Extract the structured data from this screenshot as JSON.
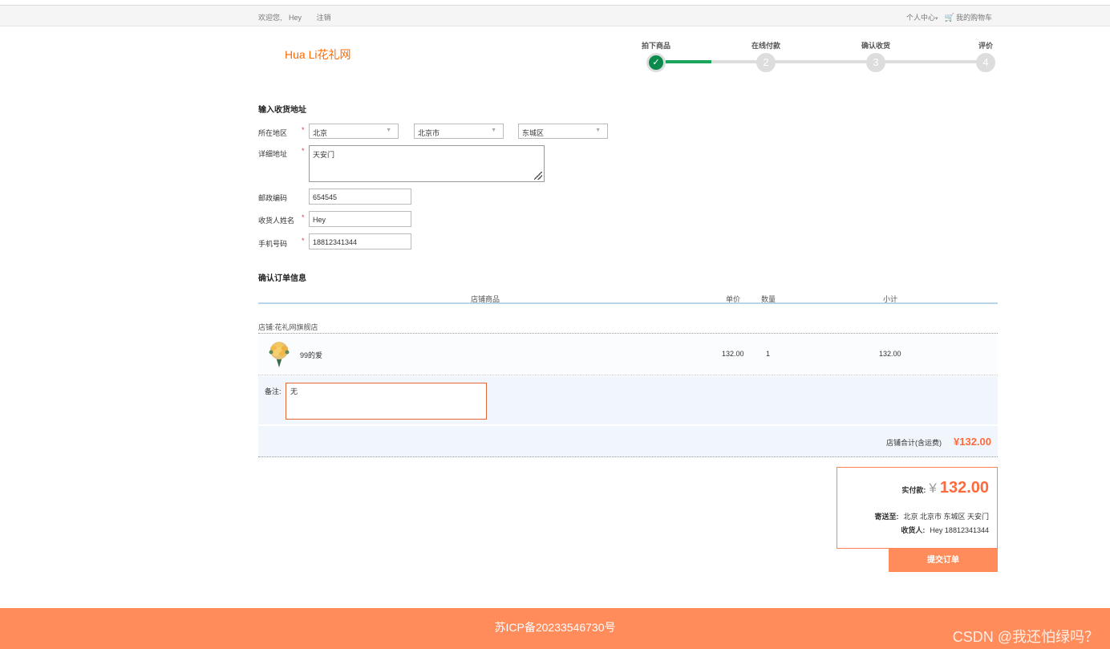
{
  "topbar": {
    "welcome": "欢迎您,",
    "username": "Hey",
    "logout": "注销",
    "personal_center": "个人中心",
    "cart": "我的购物车"
  },
  "brand": "Hua Li花礼网",
  "steps": [
    {
      "label": "拍下商品",
      "num": "",
      "done": true
    },
    {
      "label": "在线付款",
      "num": "2"
    },
    {
      "label": "确认收货",
      "num": "3"
    },
    {
      "label": "评价",
      "num": "4"
    }
  ],
  "address": {
    "title": "输入收货地址",
    "region_label": "所在地区",
    "province": "北京",
    "city": "北京市",
    "district": "东城区",
    "detail_label": "详细地址",
    "detail": "天安门",
    "zip_label": "邮政编码",
    "zip": "654545",
    "name_label": "收货人姓名",
    "name": "Hey",
    "phone_label": "手机号码",
    "phone": "18812341344",
    "required_mark": "*"
  },
  "order": {
    "title": "确认订单信息",
    "columns": {
      "goods": "店铺商品",
      "price": "单价",
      "qty": "数量",
      "subtotal": "小计"
    },
    "shop": "店铺:花礼网旗舰店",
    "item": {
      "name": "99的爱",
      "price": "132.00",
      "qty": "1",
      "subtotal": "132.00"
    },
    "memo_label": "备注:",
    "memo": "无",
    "shop_total_label": "店铺合计(含运费)",
    "shop_total": "¥132.00"
  },
  "summary": {
    "pay_label": "实付款:",
    "currency": "¥",
    "amount": "132.00",
    "ship_label": "寄送至:",
    "ship_to": "北京 北京市 东城区 天安门",
    "receiver_label": "收货人:",
    "receiver": "Hey 18812341344"
  },
  "submit": "提交订单",
  "footer": {
    "icp": "苏ICP备20233546730号",
    "watermark": "CSDN @我还怕绿吗？"
  },
  "colors": {
    "accent": "#ff8c5a",
    "price": "#ff6a3c",
    "step_done": "#0b8a4b"
  }
}
